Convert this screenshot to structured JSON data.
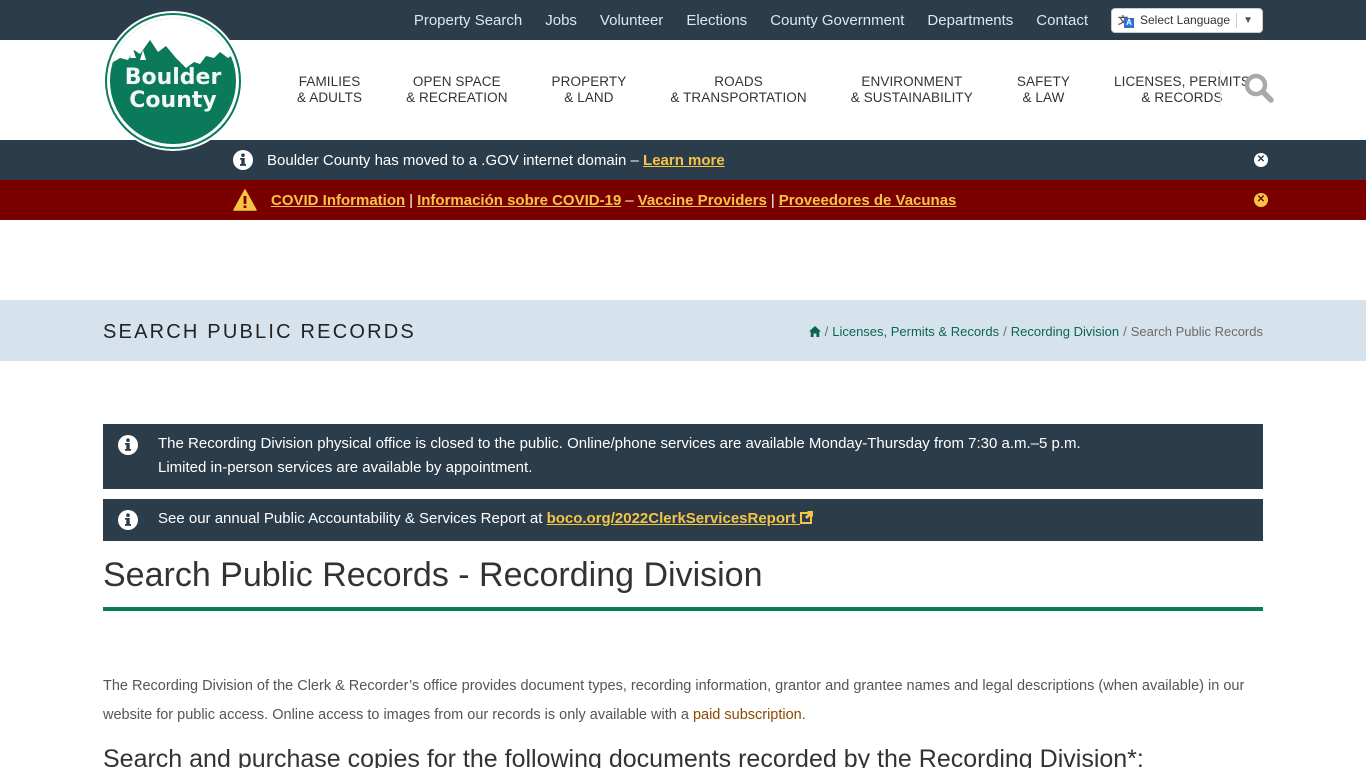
{
  "utility_nav": {
    "links": [
      "Property Search",
      "Jobs",
      "Volunteer",
      "Elections",
      "County Government",
      "Departments",
      "Contact"
    ],
    "language_select": "Select Language"
  },
  "logo": {
    "line1": "Boulder",
    "line2": "County"
  },
  "main_nav": [
    {
      "line1": "Families",
      "line2": "& Adults"
    },
    {
      "line1": "Open Space",
      "line2": "& Recreation"
    },
    {
      "line1": "Property",
      "line2": "& Land"
    },
    {
      "line1": "Roads",
      "line2": "& Transportation"
    },
    {
      "line1": "Environment",
      "line2": "& Sustainability"
    },
    {
      "line1": "Safety",
      "line2": "& Law"
    },
    {
      "line1": "Licenses, Permits",
      "line2": "& Records"
    }
  ],
  "alerts": {
    "gov_domain": {
      "text": "Boulder County has moved to a .GOV internet domain – ",
      "link": "Learn more"
    },
    "covid": {
      "link1": "COVID Information",
      "sep1": "|",
      "link2": "Información sobre COVID-19",
      "sep2": "–",
      "link3": "Vaccine Providers",
      "sep3": "|",
      "link4": "Proveedores de Vacunas"
    }
  },
  "title_band": {
    "title": "Search Public Records",
    "breadcrumb": [
      "Licenses, Permits & Records",
      "Recording Division"
    ],
    "current": "Search Public Records"
  },
  "notices": {
    "office": "The Recording Division physical office is closed to the public. Online/phone services are available Monday-Thursday from 7:30 a.m.–5 p.m. Limited in-person services are available by appointment.",
    "report_text": "See our annual Public Accountability & Services Report at ",
    "report_link": "boco.org/2022ClerkServicesReport"
  },
  "page_title": "Search Public Records - Recording Division",
  "intro": {
    "text": "The Recording Division of the Clerk & Recorder’s office provides document types, recording information, grantor and grantee names and legal descriptions (when available) in our website for public access. Online access to images from our records is only available with a ",
    "link": "paid subscription",
    "end": "."
  },
  "subheading": "Search and purchase copies for the following documents recorded by the Recording Division*:",
  "colors": {
    "dark_bar": "#2b3c4b",
    "covid_bar": "#7a0000",
    "link_yellow": "#f6c445",
    "brand_green": "#0b7a5a",
    "band_bg": "#d7e3ec"
  }
}
